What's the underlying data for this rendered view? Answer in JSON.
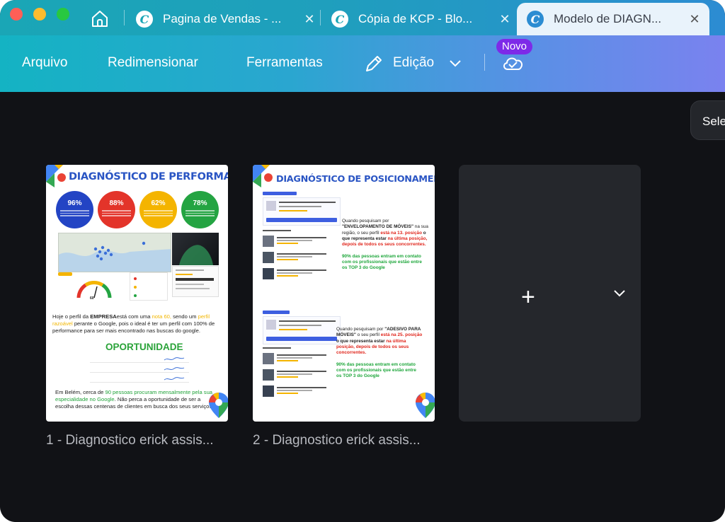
{
  "tabs": [
    {
      "title": "Pagina de Vendas - ...",
      "close": "✕",
      "active": false
    },
    {
      "title": "Cópia de KCP - Blo...",
      "close": "✕",
      "active": false
    },
    {
      "title": "Modelo de DIAGN...",
      "close": "✕",
      "active": true
    }
  ],
  "tab_logo_letter": "C",
  "menu": {
    "arquivo": "Arquivo",
    "redimensionar": "Redimensionar",
    "ferramentas": "Ferramentas",
    "edicao": "Edição",
    "novo_badge": "Novo"
  },
  "select_button": "Sele",
  "pages": [
    {
      "label": "1 - Diagnostico erick assis...",
      "title": "DIAGNÓSTICO DE PERFORMANCE",
      "stats": [
        {
          "value": "96%",
          "color": "#2344c4"
        },
        {
          "value": "88%",
          "color": "#e3342a"
        },
        {
          "value": "62%",
          "color": "#f4b400"
        },
        {
          "value": "78%",
          "color": "#24a442"
        }
      ],
      "score": "60",
      "text_1": "Hoje o perfil da ",
      "text_empresa": "EMPRESA",
      "text_2": "está com uma ",
      "text_nota": "nota 60,",
      "text_3": " sendo um ",
      "text_perfil": "perfil razoável",
      "text_4": " perante o Google, pois o ideal é ter um perfil com 100% de performance para ser mais encontrado nas buscas do google.",
      "opportunity": "OPORTUNIDADE",
      "footer_1": "Em Belém, cerca de ",
      "footer_hl": "90 pessoas procuram mensalmente pela sua especialidade no Google",
      "footer_2": ". Não perca a oportunidade de ser a escolha dessas centenas de clientes em busca dos seus serviços!"
    },
    {
      "label": "2 - Diagnostico erick assis...",
      "title": "DIAGNÓSTICO DE POSICIONAMENTO",
      "block1_a": "Quando pesquisam por",
      "block1_kw": "\"ENVELOPAMENTO DE MÓVEIS\"",
      "block1_b": " na sua região, o seu perfil ",
      "block1_pos": "está na 13. posição",
      "block1_c": " o que representa estar ",
      "block1_last": "na última posição, depois de todos os seus concorrentes.",
      "block1_green": "90% das pessoas entram em contato com os profissionais que estão entre os TOP 3 do Google",
      "block2_a": "Quando pesquisam por ",
      "block2_kw": "\"ADESIVO PARA MÓVEIS\"",
      "block2_b": " o seu perfil ",
      "block2_pos": "está na 25. posição",
      "block2_c": " o que representa estar ",
      "block2_last": "na última posição, depois de todos os seus concorrentes.",
      "block2_green": "90% das pessoas entram em contato com os profissionais que estão entre os TOP 3 do Google"
    }
  ],
  "add_page": {
    "plus": "+"
  }
}
